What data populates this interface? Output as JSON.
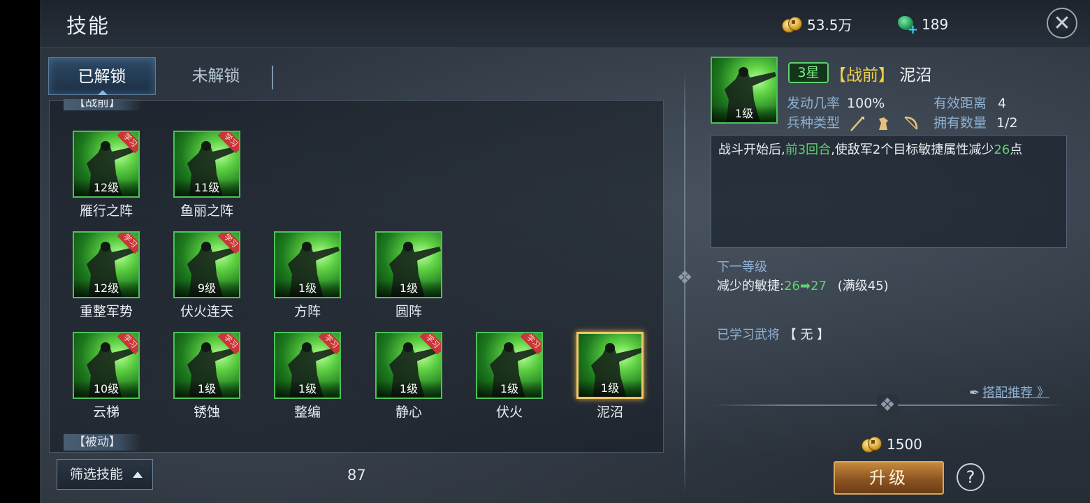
{
  "header": {
    "title": "技能",
    "gold": "53.5万",
    "jade": "189",
    "close_icon": "close-icon"
  },
  "tabs": [
    {
      "label": "已解锁",
      "active": true
    },
    {
      "label": "未解锁",
      "active": false
    }
  ],
  "sections": {
    "top_partial": "【战前】",
    "passive": "【被动】"
  },
  "skills": [
    {
      "name": "雁行之阵",
      "level": "12级",
      "learn_tag": "学习"
    },
    {
      "name": "鱼丽之阵",
      "level": "11级",
      "learn_tag": "学习"
    },
    {
      "name": "重整军势",
      "level": "12级",
      "learn_tag": "学习"
    },
    {
      "name": "伏火连天",
      "level": "9级",
      "learn_tag": "学习"
    },
    {
      "name": "方阵",
      "level": "1级",
      "learn_tag": ""
    },
    {
      "name": "圆阵",
      "level": "1级",
      "learn_tag": ""
    },
    {
      "name": "云梯",
      "level": "10级",
      "learn_tag": "学习"
    },
    {
      "name": "锈蚀",
      "level": "1级",
      "learn_tag": "学习"
    },
    {
      "name": "整编",
      "level": "1级",
      "learn_tag": "学习"
    },
    {
      "name": "静心",
      "level": "1级",
      "learn_tag": "学习"
    },
    {
      "name": "伏火",
      "level": "1级",
      "learn_tag": "学习"
    },
    {
      "name": "泥沼",
      "level": "1级",
      "learn_tag": "",
      "selected": true
    }
  ],
  "filter": {
    "label": "筛选技能"
  },
  "count": "87",
  "detail": {
    "level": "1级",
    "stars": "3星",
    "type_open": "【",
    "type": "战前",
    "type_close": "】",
    "name": "泥沼",
    "trigger_rate_label": "发动几率",
    "trigger_rate": "100%",
    "range_label": "有效距离",
    "range": "4",
    "unit_type_label": "兵种类型",
    "unit_icons": [
      "spear-icon",
      "cavalry-icon",
      "bow-icon"
    ],
    "owned_label": "拥有数量",
    "owned": "1/2",
    "description": {
      "p1": "战斗开始后,",
      "hl1": "前3回合",
      "p2": ",使敌军2个目标敏捷属性减少",
      "hl2": "26",
      "p3": "点"
    },
    "next_level_title": "下一等级",
    "next_label": "减少的敏捷:",
    "next_from": "26",
    "next_arrow": "➡",
    "next_to": "27",
    "max_note": "(满级45)",
    "learned_label": "已学习武将",
    "learned_value": "【 无 】",
    "recommend_label": "搭配推荐 》",
    "cost": "1500",
    "upgrade_label": "升级",
    "help": "?"
  },
  "colors": {
    "highlight_green": "#5fd16e",
    "label_blue": "#8fb1d1",
    "gold_border": "#f2c66a"
  }
}
